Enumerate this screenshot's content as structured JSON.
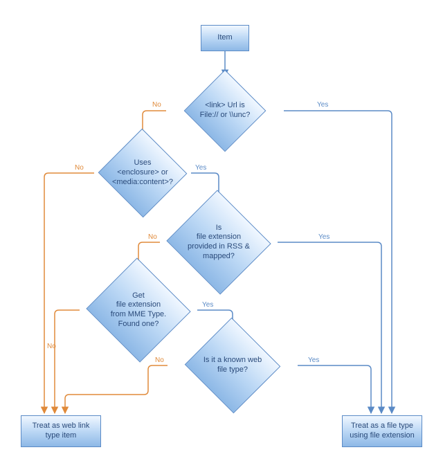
{
  "chart_data": {
    "type": "flowchart",
    "title": "",
    "nodes": [
      {
        "id": "item",
        "type": "process",
        "label": "Item"
      },
      {
        "id": "d_link",
        "type": "decision",
        "label": "<link> Url is\nFile:// or \\\\unc?"
      },
      {
        "id": "d_enc",
        "type": "decision",
        "label": "Uses\n<enclosure> or\n<media:content>?"
      },
      {
        "id": "d_ext_rss",
        "type": "decision",
        "label": "Is\nfile extension\nprovided in RSS &\nmapped?"
      },
      {
        "id": "d_mime",
        "type": "decision",
        "label": "Get\nfile extension\nfrom MME Type.\nFound one?"
      },
      {
        "id": "d_webtype",
        "type": "decision",
        "label": "Is it a known web\nfile type?"
      },
      {
        "id": "out_web",
        "type": "process",
        "label": "Treat as web link\ntype item"
      },
      {
        "id": "out_file",
        "type": "process",
        "label": "Treat as a file type\nusing file extension"
      }
    ],
    "edges": [
      {
        "from": "item",
        "to": "d_link",
        "label": ""
      },
      {
        "from": "d_link",
        "to": "out_file",
        "label": "Yes"
      },
      {
        "from": "d_link",
        "to": "d_enc",
        "label": "No"
      },
      {
        "from": "d_enc",
        "to": "d_ext_rss",
        "label": "Yes"
      },
      {
        "from": "d_enc",
        "to": "out_web",
        "label": "No"
      },
      {
        "from": "d_ext_rss",
        "to": "out_file",
        "label": "Yes"
      },
      {
        "from": "d_ext_rss",
        "to": "d_mime",
        "label": "No"
      },
      {
        "from": "d_mime",
        "to": "d_webtype",
        "label": "Yes"
      },
      {
        "from": "d_mime",
        "to": "out_web",
        "label": "No"
      },
      {
        "from": "d_webtype",
        "to": "out_file",
        "label": "Yes"
      },
      {
        "from": "d_webtype",
        "to": "out_web",
        "label": "No"
      }
    ]
  },
  "nodes": {
    "item": {
      "label": "Item"
    },
    "d_link": {
      "label": "<link> Url is\nFile:// or \\\\unc?"
    },
    "d_enc": {
      "label": "Uses\n<enclosure> or\n<media:content>?"
    },
    "d_ext_rss": {
      "label": "Is\nfile extension\nprovided in RSS &\nmapped?"
    },
    "d_mime": {
      "label": "Get\nfile extension\nfrom MME Type.\nFound one?"
    },
    "d_webtype": {
      "label": "Is it a known web\nfile type?"
    },
    "out_web": {
      "label": "Treat as web link\ntype item"
    },
    "out_file": {
      "label": "Treat as a file type\nusing file extension"
    }
  },
  "labels": {
    "yes": "Yes",
    "no": "No"
  },
  "colors": {
    "yes": "#5a8ac6",
    "no": "#e08a3a",
    "node_stroke": "#5a8ac6"
  }
}
